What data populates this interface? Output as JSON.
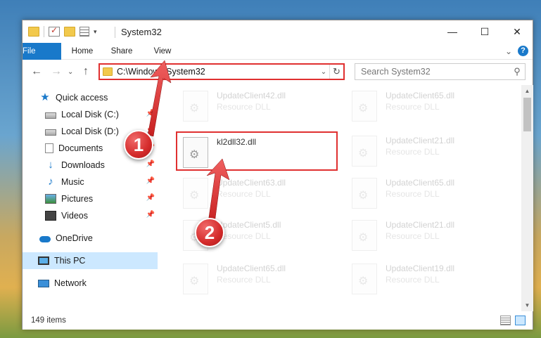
{
  "window": {
    "title": "System32",
    "controls": {
      "minimize": "—",
      "maximize": "☐",
      "close": "✕"
    }
  },
  "ribbon": {
    "tabs": [
      "File",
      "Home",
      "Share",
      "View"
    ],
    "expand_glyph": "⌄",
    "help_glyph": "?"
  },
  "nav": {
    "back": "←",
    "forward": "→",
    "dropdown": "⌄",
    "up": "↑",
    "address": "C:\\Windows\\System32",
    "address_dropdown": "⌄",
    "refresh": "↻",
    "search_placeholder": "Search System32",
    "search_glyph": "⚲"
  },
  "sidebar": {
    "items": [
      {
        "label": "Quick access",
        "icon": "star-icon"
      },
      {
        "label": "Local Disk (C:)",
        "icon": "disk-icon",
        "pinned": true
      },
      {
        "label": "Local Disk (D:)",
        "icon": "disk-icon",
        "pinned": true
      },
      {
        "label": "Documents",
        "icon": "documents-icon",
        "pinned": true
      },
      {
        "label": "Downloads",
        "icon": "downloads-icon",
        "pinned": true
      },
      {
        "label": "Music",
        "icon": "music-icon",
        "pinned": true
      },
      {
        "label": "Pictures",
        "icon": "pictures-icon",
        "pinned": true
      },
      {
        "label": "Videos",
        "icon": "videos-icon",
        "pinned": true
      },
      {
        "label": "OneDrive",
        "icon": "cloud-icon"
      },
      {
        "label": "This PC",
        "icon": "pc-icon",
        "selected": true
      },
      {
        "label": "Network",
        "icon": "network-icon"
      }
    ]
  },
  "files": [
    {
      "name": "UpdateClient42.dll",
      "type": "Resource DLL"
    },
    {
      "name": "UpdateClient65.dll",
      "type": "Resource DLL"
    },
    {
      "name": "kl2dll32.dll",
      "type": ""
    },
    {
      "name": "UpdateClient21.dll",
      "type": "Resource DLL"
    },
    {
      "name": "UpdateClient63.dll",
      "type": "Resource DLL"
    },
    {
      "name": "UpdateClient65.dll",
      "type": "Resource DLL"
    },
    {
      "name": "UpdateClient5.dll",
      "type": "Resource DLL"
    },
    {
      "name": "UpdateClient21.dll",
      "type": "Resource DLL"
    },
    {
      "name": "UpdateClient65.dll",
      "type": "Resource DLL"
    },
    {
      "name": "UpdateClient19.dll",
      "type": "Resource DLL"
    }
  ],
  "status": {
    "item_count": "149 items"
  },
  "callouts": [
    "1",
    "2"
  ],
  "colors": {
    "accent": "#1979ca",
    "highlight": "#e03030",
    "selected": "#cce8ff"
  }
}
